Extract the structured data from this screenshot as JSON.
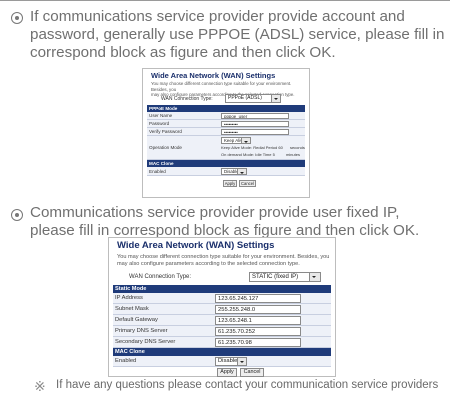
{
  "step1": {
    "line1": "If communications service provider provide account and",
    "line2": "password, generally use PPPOE (ADSL) service, please fill in",
    "line3": "correspond block as figure and then click OK."
  },
  "shot1": {
    "title": "Wide Area Network (WAN) Settings",
    "desc1": "You may choose different connection type suitable for your environment. Besides, you",
    "desc2": "may also configure parameters according to the selected connection type.",
    "conn_type_label": "WAN Connection Type:",
    "conn_type_value": "PPPoE (ADSL)",
    "section_pppoe": "PPPoE Mode",
    "user_name_label": "User Name",
    "user_name_value": "pppoe_user",
    "password_label": "Password",
    "password_value": "•••••••••",
    "verify_password_label": "Verify Password",
    "verify_password_value": "•••••••••",
    "operation_mode_label": "Operation Mode",
    "operation_mode_value": "Keep Alive",
    "keep_alive_text": "Keep Alive Mode: Redial Period  60",
    "keep_alive_unit": "seconds",
    "on_demand_text": "On demand Mode: Idle Time  5",
    "on_demand_unit": "minutes",
    "section_mac": "MAC Clone",
    "enabled_label": "Enabled",
    "enabled_value": "Disable",
    "apply": "Apply",
    "cancel": "Cancel"
  },
  "step2": {
    "line1": "Communications service provider provide user fixed IP,",
    "line2": "please fill in correspond block as figure and then click OK."
  },
  "shot2": {
    "title": "Wide Area Network (WAN) Settings",
    "desc1": "You may choose different connection type suitable for your environment. Besides, you",
    "desc2": "may also configure parameters according to the selected connection type.",
    "conn_type_label": "WAN Connection Type:",
    "conn_type_value": "STATIC (fixed IP)",
    "section_static": "Static Mode",
    "ip_label": "IP Address",
    "ip_value": "123.65.245.127",
    "subnet_label": "Subnet Mask",
    "subnet_value": "255.255.248.0",
    "gateway_label": "Default Gateway",
    "gateway_value": "123.65.248.1",
    "pdns_label": "Primary DNS Server",
    "pdns_value": "61.235.70.252",
    "sdns_label": "Secondary DNS Server",
    "sdns_value": "61.235.70.98",
    "section_mac": "MAC Clone",
    "enabled_label": "Enabled",
    "enabled_value": "Disable",
    "apply": "Apply",
    "cancel": "Cancel"
  },
  "note": {
    "icon": "※",
    "text": "If have any questions please contact your communication service providers"
  }
}
